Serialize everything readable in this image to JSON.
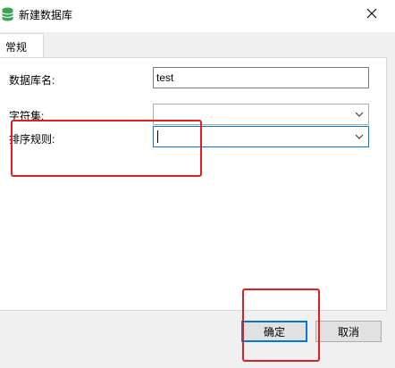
{
  "window": {
    "title": "新建数据库"
  },
  "tabs": [
    {
      "label": "常规"
    }
  ],
  "form": {
    "db_name_label": "数据库名:",
    "db_name_value": "test",
    "charset_label": "字符集:",
    "charset_value": "",
    "collation_label": "排序规则:",
    "collation_value": ""
  },
  "buttons": {
    "ok": "确定",
    "cancel": "取消"
  },
  "icons": {
    "title_icon": "database-icon",
    "close_icon": "close-icon",
    "dropdown_icon": "chevron-down-icon"
  },
  "colors": {
    "focus_accent": "#0078d7",
    "highlight_red": "#e02020",
    "db_icon_green": "#3aa655"
  }
}
